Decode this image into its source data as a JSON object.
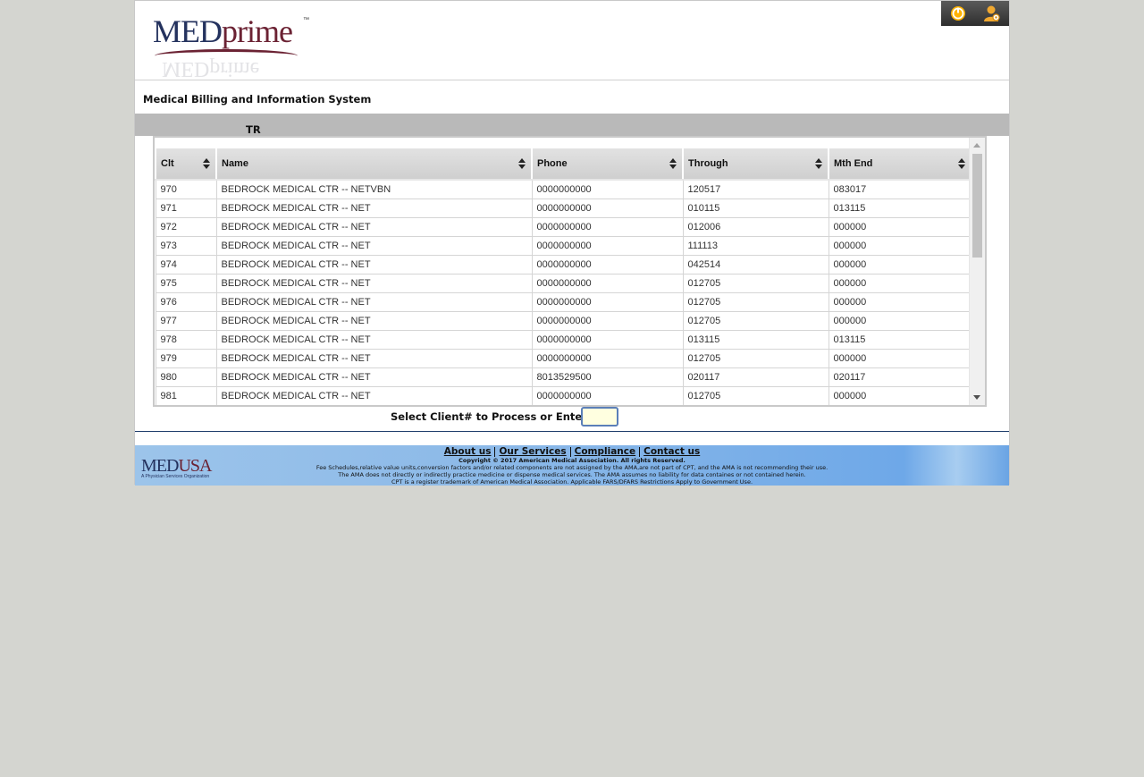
{
  "header": {
    "logo_main": "MED",
    "logo_accent": "prime",
    "logo_tm": "™",
    "system_title": "Medical Billing and Information System",
    "section_label": "TR",
    "icons": [
      "power-icon",
      "user-settings-icon"
    ]
  },
  "grid": {
    "columns": [
      "Clt",
      "Name",
      "Phone",
      "Through",
      "Mth End"
    ],
    "rows": [
      [
        "970",
        "BEDROCK MEDICAL CTR -- NETVBN",
        "0000000000",
        "120517",
        "083017"
      ],
      [
        "971",
        "BEDROCK MEDICAL CTR -- NET",
        "0000000000",
        "010115",
        "013115"
      ],
      [
        "972",
        "BEDROCK MEDICAL CTR -- NET",
        "0000000000",
        "012006",
        "000000"
      ],
      [
        "973",
        "BEDROCK MEDICAL CTR -- NET",
        "0000000000",
        "111113",
        "000000"
      ],
      [
        "974",
        "BEDROCK MEDICAL CTR -- NET",
        "0000000000",
        "042514",
        "000000"
      ],
      [
        "975",
        "BEDROCK MEDICAL CTR -- NET",
        "0000000000",
        "012705",
        "000000"
      ],
      [
        "976",
        "BEDROCK MEDICAL CTR -- NET",
        "0000000000",
        "012705",
        "000000"
      ],
      [
        "977",
        "BEDROCK MEDICAL CTR -- NET",
        "0000000000",
        "012705",
        "000000"
      ],
      [
        "978",
        "BEDROCK MEDICAL CTR -- NET",
        "0000000000",
        "013115",
        "013115"
      ],
      [
        "979",
        "BEDROCK MEDICAL CTR -- NET",
        "0000000000",
        "012705",
        "000000"
      ],
      [
        "980",
        "BEDROCK MEDICAL CTR -- NET",
        "8013529500",
        "020117",
        "020117"
      ],
      [
        "981",
        "BEDROCK MEDICAL CTR -- NET",
        "0000000000",
        "012705",
        "000000"
      ]
    ]
  },
  "prompt": {
    "label": "Select Client# to Process or Enter",
    "value": ""
  },
  "footer": {
    "logo_main": "MED",
    "logo_accent": "USA",
    "logo_tag": "A Physician Services Organization",
    "links": {
      "about": "About us",
      "services": "Our Services",
      "compliance": "Compliance",
      "contact": "Contact us"
    },
    "copyright": "Copyright © 2017 American Medical Association. All rights Reserved.",
    "notice1": "Fee Schedules,relative value units,conversion factors and/or related components are not assigned by the AMA,are not part of CPT, and the AMA is not recommending their use.",
    "notice2": "The AMA does not directly or indirectly practice medicine or dispense medical services. The AMA assumes no liability for data containes or not contained herein.",
    "notice3": "CPT is a register trademark of American Medical Association. Applicable FARS/DFARS Restrictions Apply to Government Use."
  }
}
